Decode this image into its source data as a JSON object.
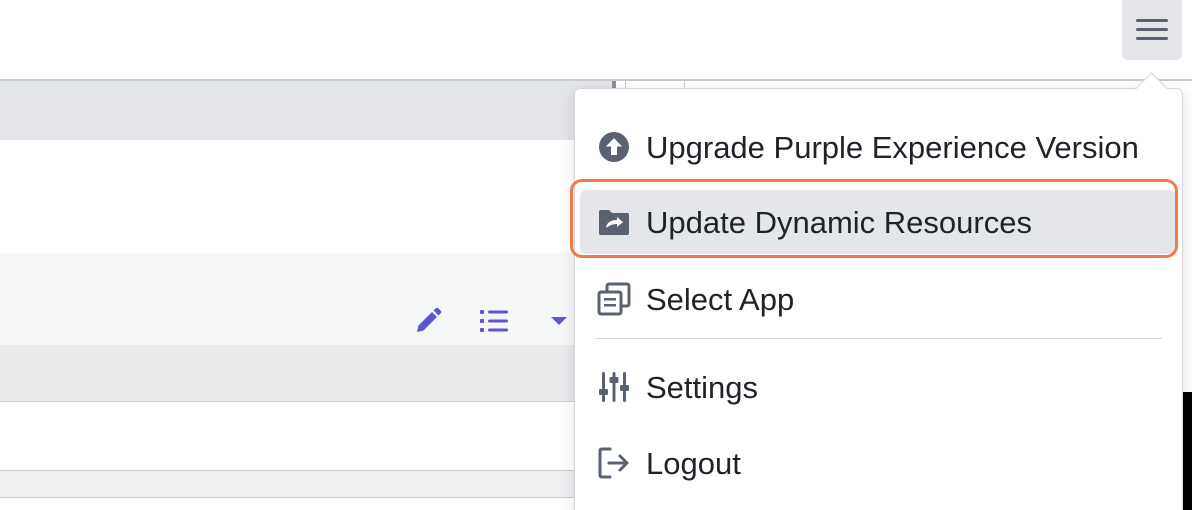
{
  "header": {
    "menu_button_icon": "hamburger-icon"
  },
  "toolbar": {
    "icons": [
      "pencil-icon",
      "list-icon",
      "caret-down-icon"
    ],
    "accent_color": "#5b57d1"
  },
  "menu": {
    "items": [
      {
        "label": "Upgrade Purple Experience Version",
        "icon": "arrow-up-circle-icon"
      },
      {
        "label": "Update Dynamic Resources",
        "icon": "folder-sync-icon",
        "highlighted": true
      },
      {
        "label": "Select App",
        "icon": "copy-stack-icon"
      },
      {
        "label": "Settings",
        "icon": "sliders-icon"
      },
      {
        "label": "Logout",
        "icon": "logout-icon"
      }
    ],
    "highlight_color": "#f07b4a",
    "hover_color": "#e4e6ea"
  }
}
